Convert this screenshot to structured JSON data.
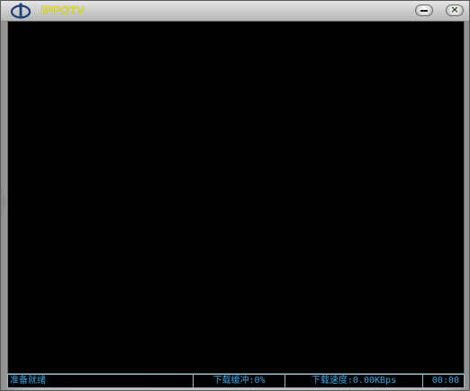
{
  "window": {
    "title": "iPPOTV",
    "minimize_glyph": "",
    "close_glyph": "×"
  },
  "statusbar": {
    "status": "准备就绪",
    "buffer": "下载缓冲:0%",
    "speed": "下载速度:0.00KBps",
    "time": "00:00"
  },
  "colors": {
    "title": "#f3f000",
    "status_text": "#39a7e8",
    "status_border": "#8fb7cf",
    "video_bg": "#000000"
  },
  "icons": {
    "logo": "pptv-logo-icon",
    "minimize": "minimize-icon",
    "close": "close-icon"
  }
}
